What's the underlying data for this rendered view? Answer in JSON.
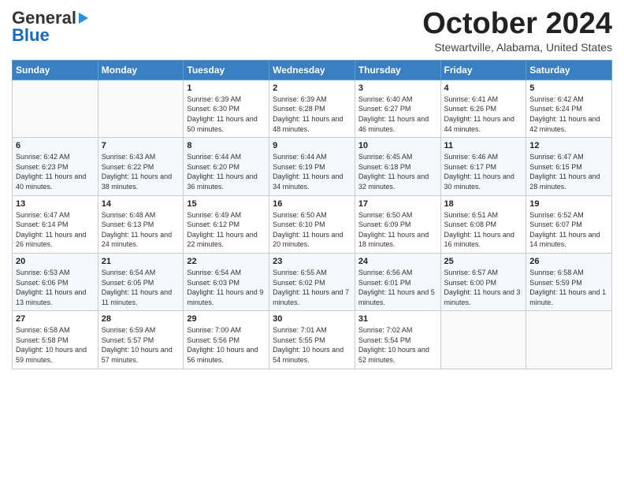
{
  "header": {
    "logo_general": "General",
    "logo_blue": "Blue",
    "month_title": "October 2024",
    "location": "Stewartville, Alabama, United States"
  },
  "days_of_week": [
    "Sunday",
    "Monday",
    "Tuesday",
    "Wednesday",
    "Thursday",
    "Friday",
    "Saturday"
  ],
  "weeks": [
    [
      {
        "day": "",
        "info": ""
      },
      {
        "day": "",
        "info": ""
      },
      {
        "day": "1",
        "info": "Sunrise: 6:39 AM\nSunset: 6:30 PM\nDaylight: 11 hours and 50 minutes."
      },
      {
        "day": "2",
        "info": "Sunrise: 6:39 AM\nSunset: 6:28 PM\nDaylight: 11 hours and 48 minutes."
      },
      {
        "day": "3",
        "info": "Sunrise: 6:40 AM\nSunset: 6:27 PM\nDaylight: 11 hours and 46 minutes."
      },
      {
        "day": "4",
        "info": "Sunrise: 6:41 AM\nSunset: 6:26 PM\nDaylight: 11 hours and 44 minutes."
      },
      {
        "day": "5",
        "info": "Sunrise: 6:42 AM\nSunset: 6:24 PM\nDaylight: 11 hours and 42 minutes."
      }
    ],
    [
      {
        "day": "6",
        "info": "Sunrise: 6:42 AM\nSunset: 6:23 PM\nDaylight: 11 hours and 40 minutes."
      },
      {
        "day": "7",
        "info": "Sunrise: 6:43 AM\nSunset: 6:22 PM\nDaylight: 11 hours and 38 minutes."
      },
      {
        "day": "8",
        "info": "Sunrise: 6:44 AM\nSunset: 6:20 PM\nDaylight: 11 hours and 36 minutes."
      },
      {
        "day": "9",
        "info": "Sunrise: 6:44 AM\nSunset: 6:19 PM\nDaylight: 11 hours and 34 minutes."
      },
      {
        "day": "10",
        "info": "Sunrise: 6:45 AM\nSunset: 6:18 PM\nDaylight: 11 hours and 32 minutes."
      },
      {
        "day": "11",
        "info": "Sunrise: 6:46 AM\nSunset: 6:17 PM\nDaylight: 11 hours and 30 minutes."
      },
      {
        "day": "12",
        "info": "Sunrise: 6:47 AM\nSunset: 6:15 PM\nDaylight: 11 hours and 28 minutes."
      }
    ],
    [
      {
        "day": "13",
        "info": "Sunrise: 6:47 AM\nSunset: 6:14 PM\nDaylight: 11 hours and 26 minutes."
      },
      {
        "day": "14",
        "info": "Sunrise: 6:48 AM\nSunset: 6:13 PM\nDaylight: 11 hours and 24 minutes."
      },
      {
        "day": "15",
        "info": "Sunrise: 6:49 AM\nSunset: 6:12 PM\nDaylight: 11 hours and 22 minutes."
      },
      {
        "day": "16",
        "info": "Sunrise: 6:50 AM\nSunset: 6:10 PM\nDaylight: 11 hours and 20 minutes."
      },
      {
        "day": "17",
        "info": "Sunrise: 6:50 AM\nSunset: 6:09 PM\nDaylight: 11 hours and 18 minutes."
      },
      {
        "day": "18",
        "info": "Sunrise: 6:51 AM\nSunset: 6:08 PM\nDaylight: 11 hours and 16 minutes."
      },
      {
        "day": "19",
        "info": "Sunrise: 6:52 AM\nSunset: 6:07 PM\nDaylight: 11 hours and 14 minutes."
      }
    ],
    [
      {
        "day": "20",
        "info": "Sunrise: 6:53 AM\nSunset: 6:06 PM\nDaylight: 11 hours and 13 minutes."
      },
      {
        "day": "21",
        "info": "Sunrise: 6:54 AM\nSunset: 6:05 PM\nDaylight: 11 hours and 11 minutes."
      },
      {
        "day": "22",
        "info": "Sunrise: 6:54 AM\nSunset: 6:03 PM\nDaylight: 11 hours and 9 minutes."
      },
      {
        "day": "23",
        "info": "Sunrise: 6:55 AM\nSunset: 6:02 PM\nDaylight: 11 hours and 7 minutes."
      },
      {
        "day": "24",
        "info": "Sunrise: 6:56 AM\nSunset: 6:01 PM\nDaylight: 11 hours and 5 minutes."
      },
      {
        "day": "25",
        "info": "Sunrise: 6:57 AM\nSunset: 6:00 PM\nDaylight: 11 hours and 3 minutes."
      },
      {
        "day": "26",
        "info": "Sunrise: 6:58 AM\nSunset: 5:59 PM\nDaylight: 11 hours and 1 minute."
      }
    ],
    [
      {
        "day": "27",
        "info": "Sunrise: 6:58 AM\nSunset: 5:58 PM\nDaylight: 10 hours and 59 minutes."
      },
      {
        "day": "28",
        "info": "Sunrise: 6:59 AM\nSunset: 5:57 PM\nDaylight: 10 hours and 57 minutes."
      },
      {
        "day": "29",
        "info": "Sunrise: 7:00 AM\nSunset: 5:56 PM\nDaylight: 10 hours and 56 minutes."
      },
      {
        "day": "30",
        "info": "Sunrise: 7:01 AM\nSunset: 5:55 PM\nDaylight: 10 hours and 54 minutes."
      },
      {
        "day": "31",
        "info": "Sunrise: 7:02 AM\nSunset: 5:54 PM\nDaylight: 10 hours and 52 minutes."
      },
      {
        "day": "",
        "info": ""
      },
      {
        "day": "",
        "info": ""
      }
    ]
  ]
}
